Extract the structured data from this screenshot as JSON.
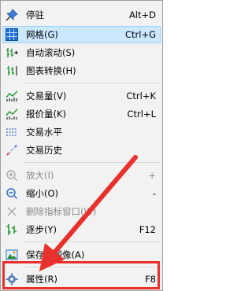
{
  "menu": {
    "items": [
      {
        "label": "停驻",
        "shortcut": "Alt+D",
        "icon": "pin-icon"
      },
      {
        "label": "网格(G)",
        "shortcut": "Ctrl+G",
        "icon": "grid-icon"
      },
      {
        "label": "自动滚动(S)",
        "shortcut": "",
        "icon": "auto-scroll-icon"
      },
      {
        "label": "图表转换(H)",
        "shortcut": "",
        "icon": "chart-shift-icon"
      },
      {
        "label": "交易量(V)",
        "shortcut": "Ctrl+K",
        "icon": "volume-icon"
      },
      {
        "label": "报价量(K)",
        "shortcut": "Ctrl+L",
        "icon": "tick-volume-icon"
      },
      {
        "label": "交易水平",
        "shortcut": "",
        "icon": "trade-levels-icon"
      },
      {
        "label": "交易历史",
        "shortcut": "",
        "icon": "trade-history-icon"
      },
      {
        "label": "放大(I)",
        "shortcut": "+",
        "icon": "zoom-in-icon"
      },
      {
        "label": "缩小(O)",
        "shortcut": "-",
        "icon": "zoom-out-icon"
      },
      {
        "label": "删除指标窗口(W)",
        "shortcut": "",
        "icon": "close-x-icon"
      },
      {
        "label": "逐步(Y)",
        "shortcut": "F12",
        "icon": "step-icon"
      },
      {
        "label": "保存为图像(A)",
        "shortcut": "",
        "icon": "save-image-icon"
      },
      {
        "label": "属性(R)",
        "shortcut": "F8",
        "icon": "gear-icon"
      }
    ]
  },
  "colors": {
    "menu_bg": "#f2f2f2",
    "highlight": "#cce8ff",
    "disabled_text": "#8a8a8a",
    "annotation_red": "#e8302c"
  }
}
